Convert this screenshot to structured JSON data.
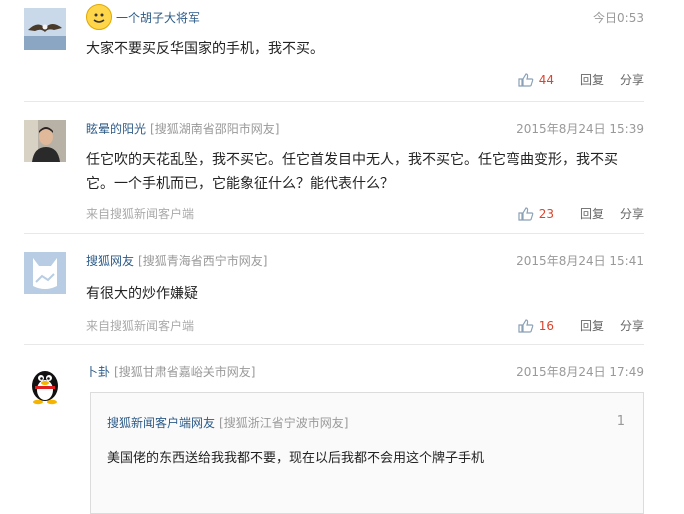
{
  "comments": [
    {
      "user": "一个胡子大将军",
      "location": "",
      "time": "今日0:53",
      "text": "大家不要买反华国家的手机，我不买。",
      "source": "",
      "likes": "44",
      "reply_label": "回复",
      "share_label": "分享"
    },
    {
      "user": "眩晕的阳光",
      "location": "[搜狐湖南省邵阳市网友]",
      "time": "2015年8月24日 15:39",
      "text_line1": "任它吹的天花乱坠，我不买它。任它首发目中无人，我不买它。任它弯曲变形，我不买",
      "text_line2": "它。一个手机而已，它能象征什么？能代表什么？",
      "source": "来自搜狐新闻客户端",
      "likes": "23",
      "reply_label": "回复",
      "share_label": "分享"
    },
    {
      "user": "搜狐网友",
      "location": "[搜狐青海省西宁市网友]",
      "time": "2015年8月24日 15:41",
      "text": "有很大的炒作嫌疑",
      "source": "来自搜狐新闻客户端",
      "likes": "16",
      "reply_label": "回复",
      "share_label": "分享"
    },
    {
      "user": "卜卦",
      "location": "[搜狐甘肃省嘉峪关市网友]",
      "time": "2015年8月24日 17:49",
      "quote": {
        "user": "搜狐新闻客户端网友",
        "location": "[搜狐浙江省宁波市网友]",
        "floor": "1",
        "text": "美国佬的东西送给我我都不要，现在以后我都不会用这个牌子手机"
      }
    }
  ]
}
